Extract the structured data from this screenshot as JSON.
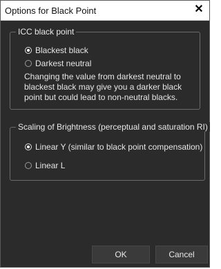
{
  "window": {
    "title": "Options for Black Point",
    "close_glyph": "✕"
  },
  "icc_group": {
    "title": "ICC black point",
    "options": [
      {
        "label": "Blackest black",
        "checked": true
      },
      {
        "label": "Darkest neutral",
        "checked": false
      }
    ],
    "description": "Changing the value from darkest neutral to blackest black may give you a darker black point but could lead to non-neutral blacks."
  },
  "scaling_group": {
    "title": "Scaling of Brightness (perceptual and saturation RI)",
    "options": [
      {
        "label": "Linear Y (similar to black point compensation)",
        "checked": true
      },
      {
        "label": "Linear L",
        "checked": false
      }
    ]
  },
  "buttons": {
    "ok": "OK",
    "cancel": "Cancel"
  }
}
